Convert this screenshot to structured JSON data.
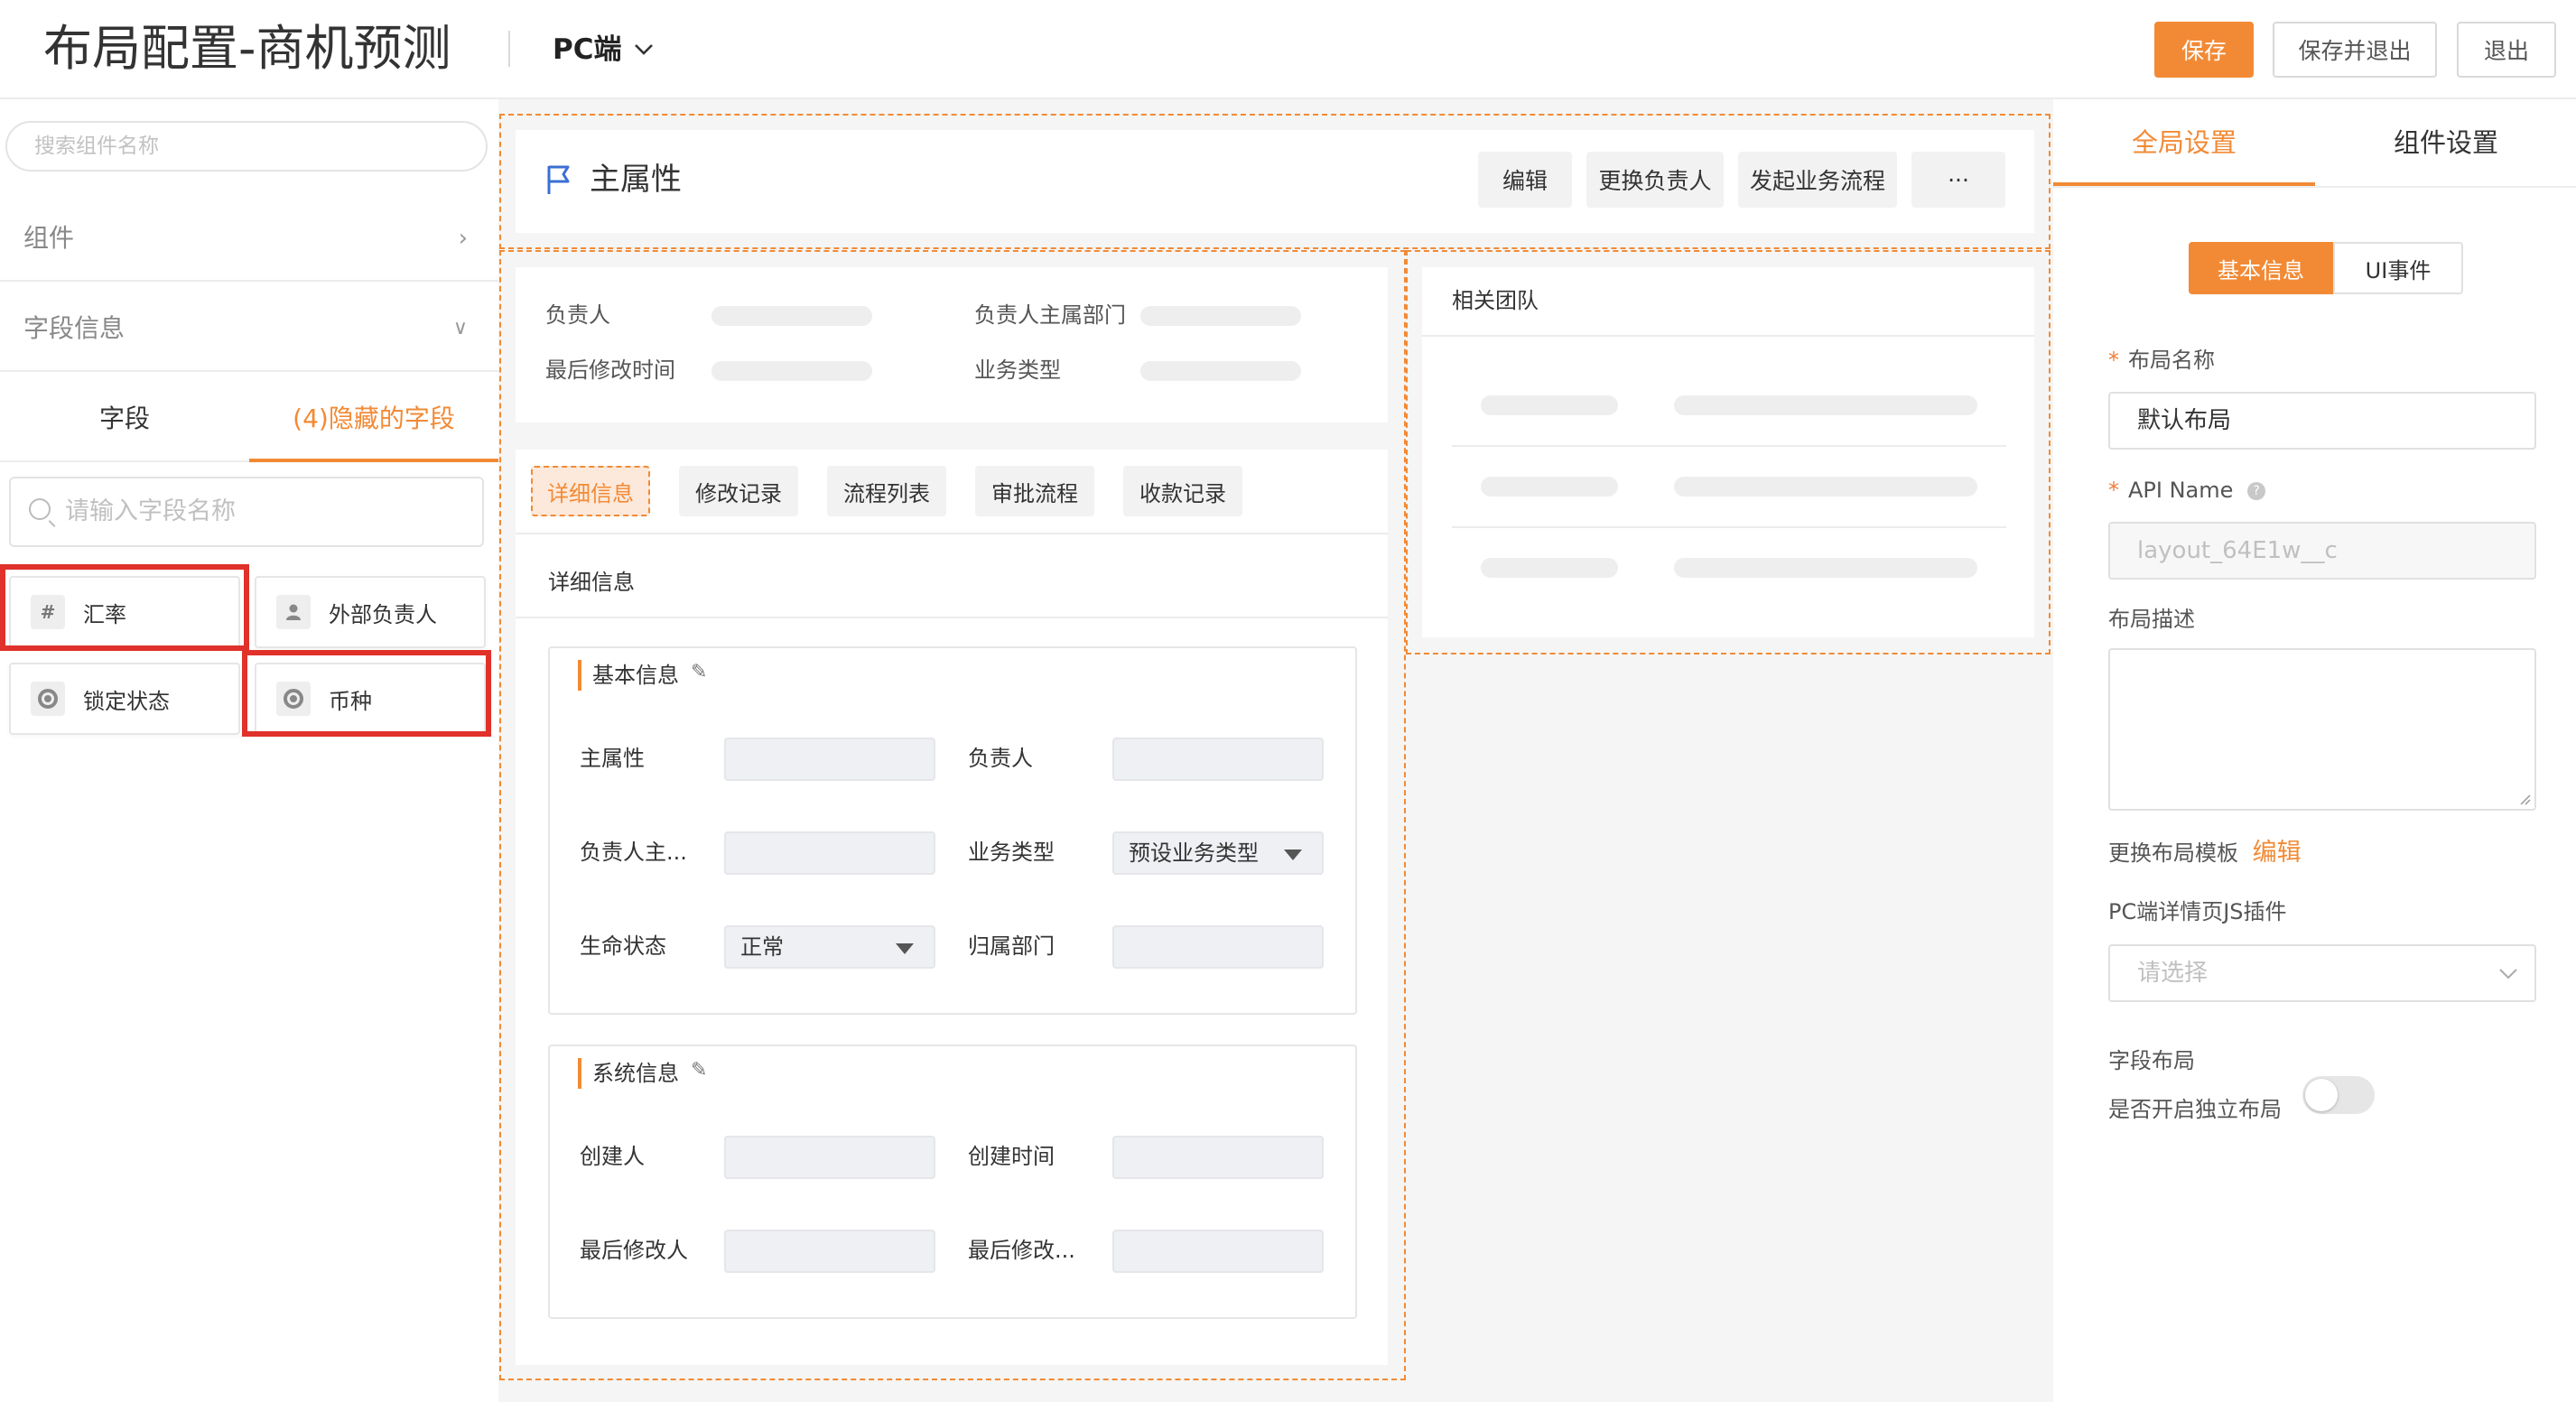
{
  "header": {
    "title": "布局配置-商机预测",
    "device": "PC端",
    "save": "保存",
    "save_exit": "保存并退出",
    "exit": "退出"
  },
  "left": {
    "search_placeholder": "搜索组件名称",
    "components_label": "组件",
    "field_info_label": "字段信息",
    "tabs": [
      "字段",
      "(4)隐藏的字段"
    ],
    "field_search_placeholder": "请输入字段名称",
    "fields": [
      {
        "label": "汇率",
        "icon": "hash-icon"
      },
      {
        "label": "外部负责人",
        "icon": "person-icon"
      },
      {
        "label": "锁定状态",
        "icon": "radio-icon"
      },
      {
        "label": "币种",
        "icon": "radio-icon"
      }
    ]
  },
  "center": {
    "main_title": "主属性",
    "actions": [
      "编辑",
      "更换负责人",
      "发起业务流程",
      "···"
    ],
    "summary_labels": [
      "负责人",
      "负责人主属部门",
      "最后修改时间",
      "业务类型"
    ],
    "tabs": [
      "详细信息",
      "修改记录",
      "流程列表",
      "审批流程",
      "收款记录"
    ],
    "detail_heading": "详细信息",
    "basic_section": {
      "title": "基本信息",
      "fields": [
        {
          "label": "主属性",
          "value": ""
        },
        {
          "label": "负责人",
          "value": ""
        },
        {
          "label": "负责人主...",
          "value": ""
        },
        {
          "label": "业务类型",
          "value": "预设业务类型"
        },
        {
          "label": "生命状态",
          "value": "正常"
        },
        {
          "label": "归属部门",
          "value": ""
        }
      ]
    },
    "system_section": {
      "title": "系统信息",
      "fields": [
        {
          "label": "创建人",
          "value": ""
        },
        {
          "label": "创建时间",
          "value": ""
        },
        {
          "label": "最后修改人",
          "value": ""
        },
        {
          "label": "最后修改...",
          "value": ""
        }
      ]
    },
    "team_title": "相关团队"
  },
  "right": {
    "tabs": [
      "全局设置",
      "组件设置"
    ],
    "segments": [
      "基本信息",
      "UI事件"
    ],
    "layout_name_label": "布局名称",
    "layout_name_value": "默认布局",
    "api_name_label": "API Name",
    "api_name_value": "layout_64E1w__c",
    "layout_desc_label": "布局描述",
    "change_template_label": "更换布局模板",
    "change_template_link": "编辑",
    "js_plugin_label": "PC端详情页JS插件",
    "js_plugin_placeholder": "请选择",
    "field_layout_label": "字段布局",
    "independent_layout_label": "是否开启独立布局"
  },
  "colors": {
    "accent": "#f28a35",
    "highlight": "#e0312a"
  }
}
